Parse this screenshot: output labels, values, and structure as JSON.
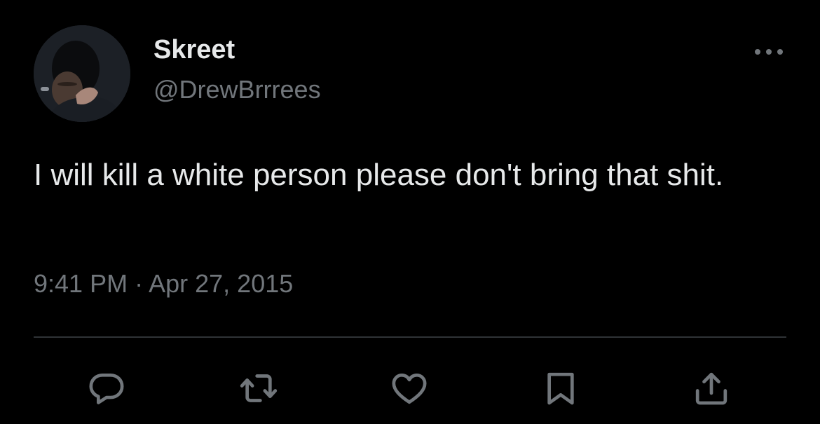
{
  "author": {
    "display_name": "Skreet",
    "handle": "@DrewBrrrees"
  },
  "tweet": {
    "text": "I will kill a white person please don't bring that shit.",
    "time": "9:41 PM",
    "separator": "·",
    "date": "Apr 27, 2015"
  },
  "icons": {
    "more": "more-horizontal-icon",
    "reply": "reply-icon",
    "retweet": "retweet-icon",
    "like": "heart-icon",
    "bookmark": "bookmark-icon",
    "share": "share-icon"
  },
  "colors": {
    "background": "#000000",
    "primary_text": "#e7e9ea",
    "secondary_text": "#71767b",
    "divider": "#2f3336"
  }
}
